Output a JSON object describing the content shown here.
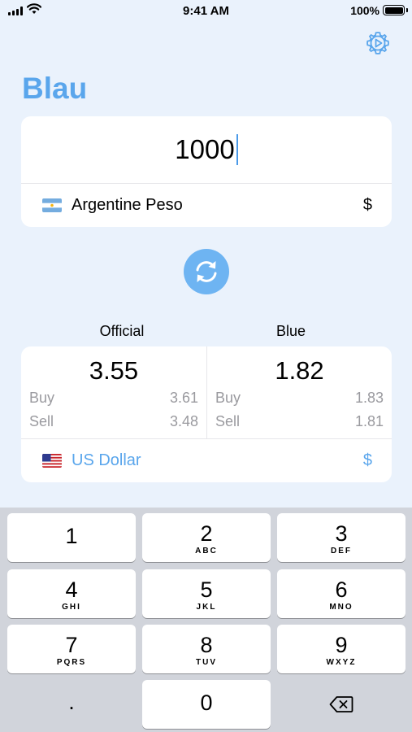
{
  "status_bar": {
    "time": "9:41 AM",
    "battery": "100%"
  },
  "app": {
    "title": "Blau"
  },
  "input": {
    "amount": "1000",
    "currency_name": "Argentine Peso",
    "currency_symbol": "$",
    "flag_icon": "argentina-flag-icon"
  },
  "rates": {
    "official": {
      "header": "Official",
      "rate": "3.55",
      "buy_label": "Buy",
      "buy": "3.61",
      "sell_label": "Sell",
      "sell": "3.48"
    },
    "blue": {
      "header": "Blue",
      "rate": "1.82",
      "buy_label": "Buy",
      "buy": "1.83",
      "sell_label": "Sell",
      "sell": "1.81"
    }
  },
  "target": {
    "currency_name": "US Dollar",
    "currency_symbol": "$",
    "flag_icon": "us-flag-icon"
  },
  "keyboard": {
    "keys": [
      {
        "digit": "1",
        "letters": ""
      },
      {
        "digit": "2",
        "letters": "ABC"
      },
      {
        "digit": "3",
        "letters": "DEF"
      },
      {
        "digit": "4",
        "letters": "GHI"
      },
      {
        "digit": "5",
        "letters": "JKL"
      },
      {
        "digit": "6",
        "letters": "MNO"
      },
      {
        "digit": "7",
        "letters": "PQRS"
      },
      {
        "digit": "8",
        "letters": "TUV"
      },
      {
        "digit": "9",
        "letters": "WXYZ"
      }
    ],
    "decimal": ".",
    "zero": "0",
    "delete_icon": "backspace-icon"
  },
  "colors": {
    "accent": "#5aa6ec",
    "swap_button": "#6eb4f2",
    "background": "#eaf2fc",
    "keyboard": "#d1d4db"
  }
}
